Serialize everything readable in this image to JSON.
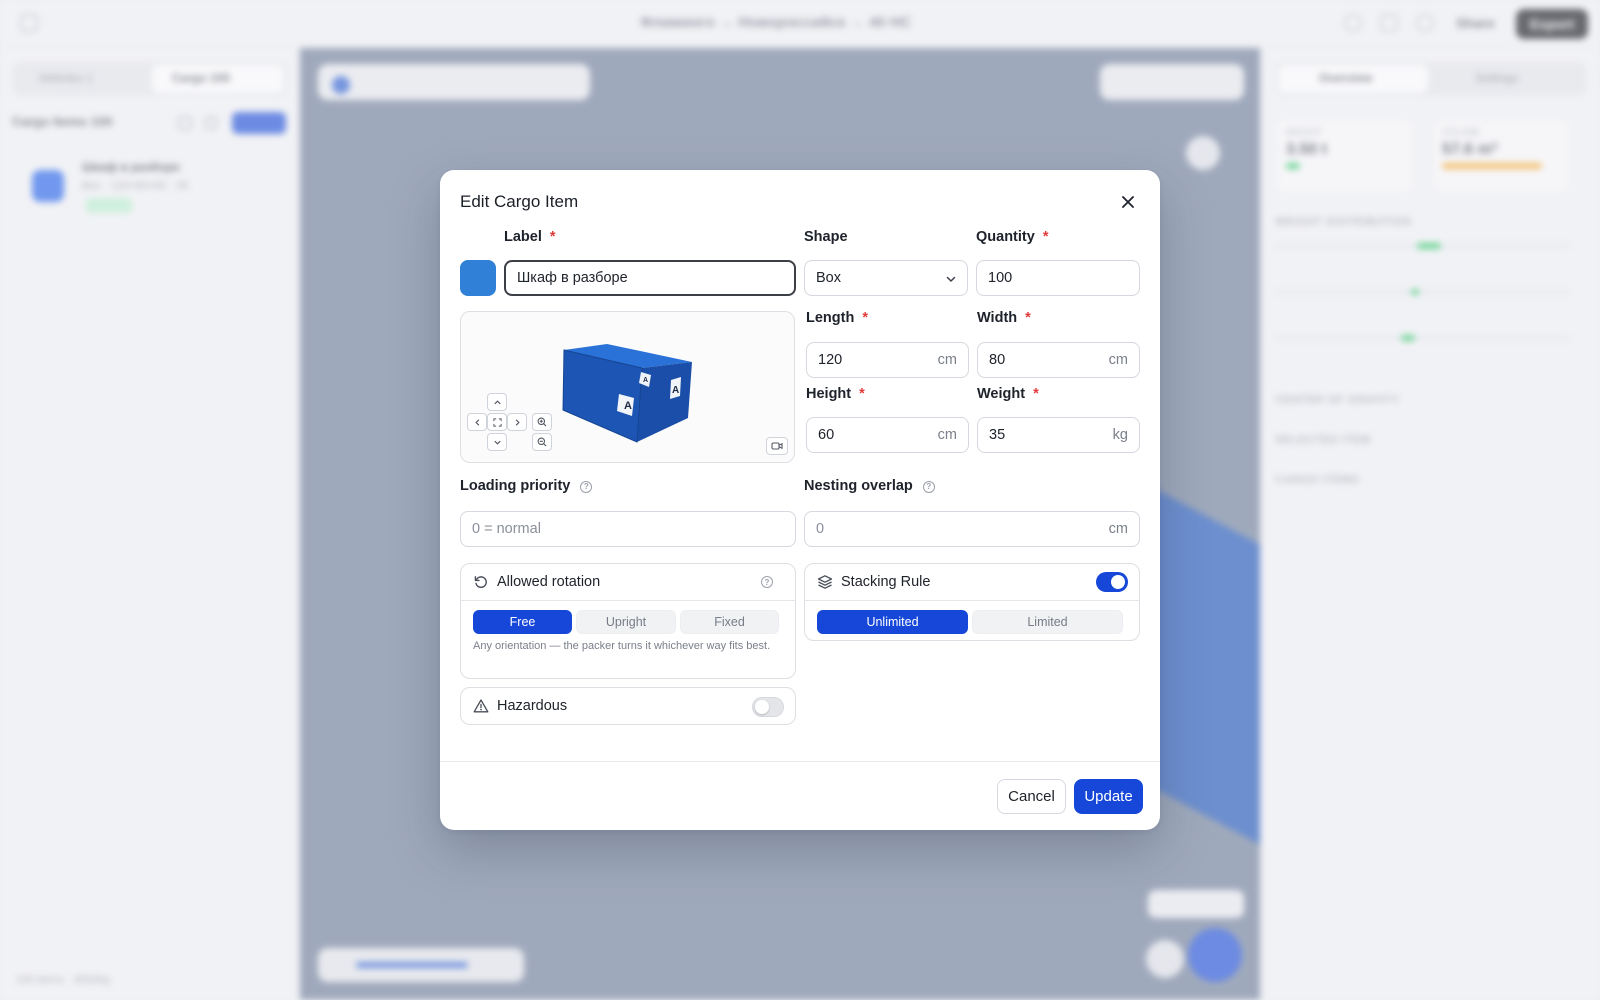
{
  "background": {
    "breadcrumb": "Фламинго → Новороссийск → 40 HC",
    "share": "Share",
    "export": "Export",
    "left": {
      "tab_vehicles": "Vehicles 1",
      "tab_cargo": "Cargo 100",
      "cargo_items": "Cargo Items 100",
      "new_button": "+ New",
      "item_title": "Шкаф в разборе",
      "item_sub": "Box · 120×80×60 · 35",
      "footer": "100 items · 3500kg"
    },
    "right": {
      "tab_overview": "Overview",
      "tab_settings": "Settings",
      "weight_label": "WEIGHT",
      "weight_value": "3.50 t",
      "volume_label": "VOLUME",
      "volume_value": "57.6 m³",
      "sections": [
        "WEIGHT DISTRIBUTION",
        "CENTER OF GRAVITY",
        "SELECTED ITEM",
        "CARGO ITEMS"
      ]
    }
  },
  "modal": {
    "title": "Edit Cargo Item",
    "label_field": {
      "label": "Label",
      "value": "Шкаф в разборе",
      "color": "#2f80d6"
    },
    "shape_field": {
      "label": "Shape",
      "value": "Box"
    },
    "quantity_field": {
      "label": "Quantity",
      "value": "100"
    },
    "length_field": {
      "label": "Length",
      "value": "120",
      "unit": "cm"
    },
    "width_field": {
      "label": "Width",
      "value": "80",
      "unit": "cm"
    },
    "height_field": {
      "label": "Height",
      "value": "60",
      "unit": "cm"
    },
    "weight_field": {
      "label": "Weight",
      "value": "35",
      "unit": "kg"
    },
    "required_mark": "*",
    "preview": {
      "face_letter": "A",
      "box_color": "#1d5fc7"
    },
    "loading_priority": {
      "label": "Loading priority",
      "placeholder": "0 = normal"
    },
    "nesting_overlap": {
      "label": "Nesting overlap",
      "placeholder": "0",
      "unit": "cm"
    },
    "help_glyph": "?",
    "rotation": {
      "title": "Allowed rotation",
      "options": [
        "Free",
        "Upright",
        "Fixed"
      ],
      "selected": "Free",
      "hint": "Any orientation — the packer turns it whichever way fits best."
    },
    "stacking": {
      "title": "Stacking Rule",
      "enabled": true,
      "options": [
        "Unlimited",
        "Limited"
      ],
      "selected": "Unlimited"
    },
    "hazardous": {
      "title": "Hazardous",
      "enabled": false
    },
    "cancel_label": "Cancel",
    "update_label": "Update",
    "accent": "#1747d8"
  }
}
